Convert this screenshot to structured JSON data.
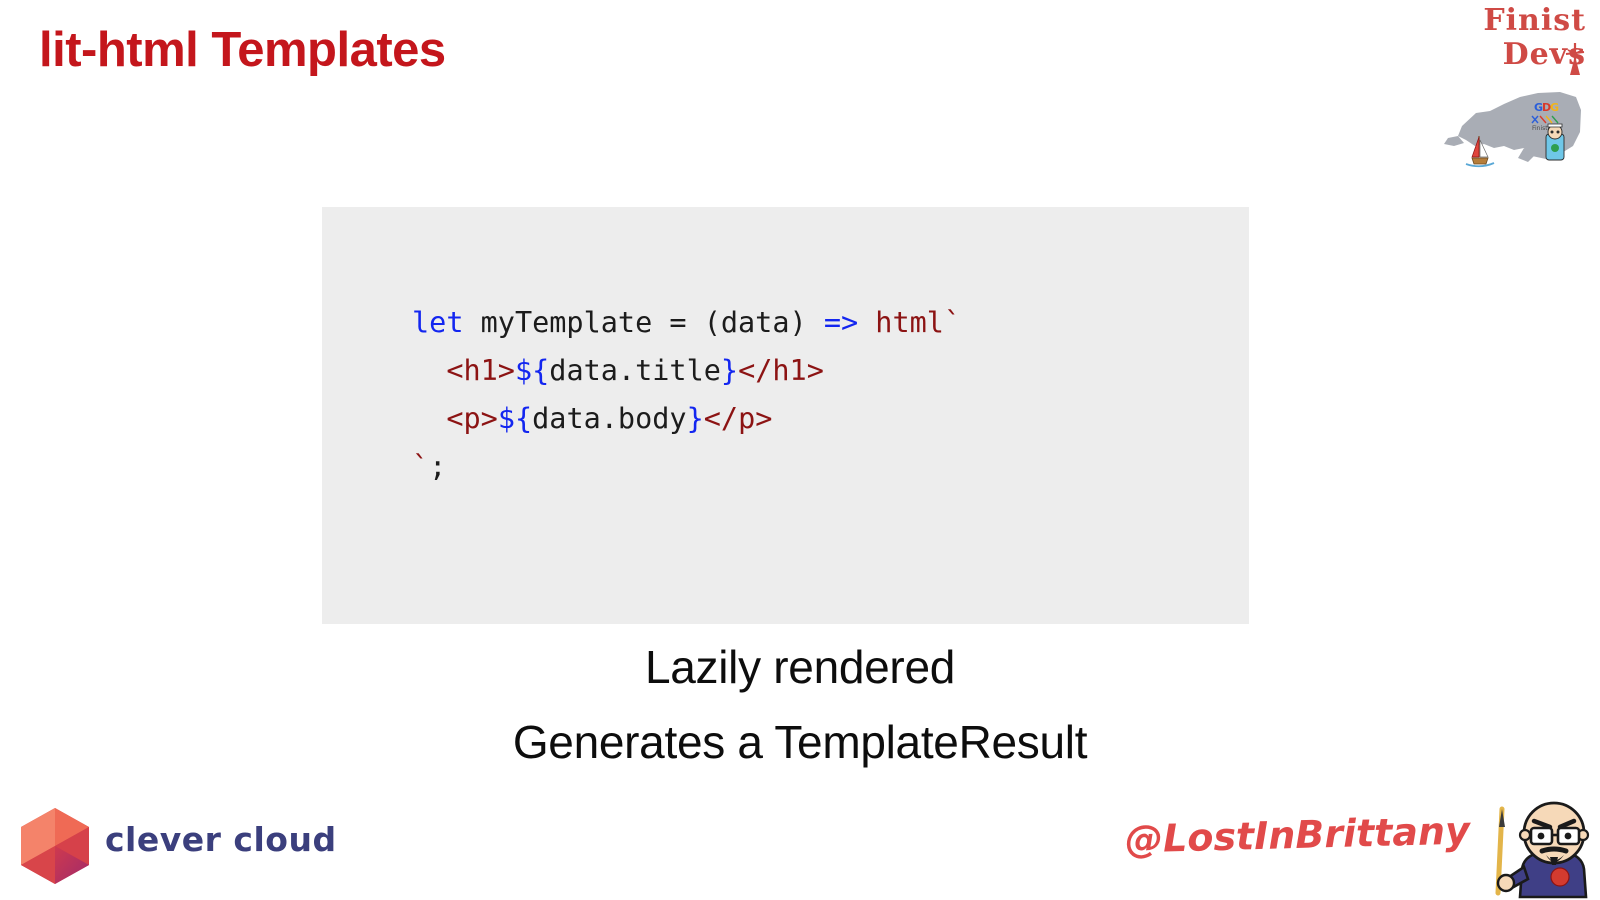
{
  "slide": {
    "title": "lit-html Templates",
    "background_color": "#ffffff",
    "title_color": "#c4161c"
  },
  "code_block": {
    "background_color": "#ededed",
    "language": "javascript",
    "lines": [
      "let myTemplate = (data) => html`",
      "  <h1>${data.title}</h1>",
      "  <p>${data.body}</p>",
      "`;"
    ],
    "tokens": {
      "line1": {
        "kw": "let",
        "ident": " myTemplate = (data) ",
        "arrow": "=>",
        "tag": " html",
        "backtick": "`"
      },
      "line2": {
        "indent": "  ",
        "open_tag": "<h1>",
        "expr_open": "${",
        "expr": "data.title",
        "expr_close": "}",
        "close_tag": "</h1>"
      },
      "line3": {
        "indent": "  ",
        "open_tag": "<p>",
        "expr_open": "${",
        "expr": "data.body",
        "expr_close": "}",
        "close_tag": "</p>"
      },
      "line4": {
        "backtick": "`",
        "semicolon": ";"
      }
    },
    "colors": {
      "keyword": "#1326f0",
      "tag": "#8c1313",
      "expression": "#1326f0",
      "plain": "#1c1c1c"
    }
  },
  "captions": [
    "Lazily rendered",
    "Generates a TemplateResult"
  ],
  "finist_devs_logo": {
    "line1": "Finist",
    "line2": "Devs",
    "color": "#cf4a45",
    "icon": "lighthouse-icon",
    "badge_text": "GDG",
    "badge_subtext": "Finistère"
  },
  "clever_cloud_logo": {
    "wordmark": "clever cloud",
    "wordmark_color": "#3b3f7d",
    "mark_colors": [
      "#f2705a",
      "#e0453c",
      "#b02a62"
    ]
  },
  "lost_in_brittany": {
    "handle": "@LostInBrittany",
    "handle_color": "#e14a4a",
    "avatar": "speaker-avatar"
  }
}
